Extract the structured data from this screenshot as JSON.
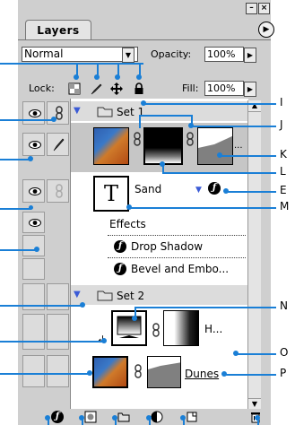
{
  "panel": {
    "window_buttons": [
      "–",
      "×"
    ],
    "tab_label": "Layers",
    "blend_mode": "Normal",
    "opacity_label": "Opacity:",
    "opacity_value": "100%",
    "lock_label": "Lock:",
    "fill_label": "Fill:",
    "fill_value": "100%"
  },
  "layers": {
    "set1_name": "Set 1",
    "sand_name": "Sand",
    "effects_label": "Effects",
    "effect1": "Drop Shadow",
    "effect2": "Bevel and Embo...",
    "set2_name": "Set 2",
    "adjust_name": "H...",
    "dunes_name": "Dunes",
    "mask_ellipsis": "...",
    "type_thumb_glyph": "T"
  },
  "callouts": {
    "I": "I",
    "J": "J",
    "K": "K",
    "L": "L",
    "E": "E",
    "M": "M",
    "N": "N",
    "O": "O",
    "P": "P"
  },
  "icons": [
    "visibility-eye-icon",
    "link-chain-icon",
    "brush-icon",
    "lock-transparent-icon",
    "lock-paint-icon",
    "lock-move-icon",
    "lock-all-icon",
    "folder-icon",
    "effects-f-icon",
    "trash-icon",
    "new-layer-icon",
    "new-set-icon",
    "mask-icon",
    "adjustment-icon"
  ],
  "colors": {
    "accent": "#1a7fd6",
    "panel_bg": "#cfcfcf",
    "selected_row": "#c6c6c6"
  }
}
